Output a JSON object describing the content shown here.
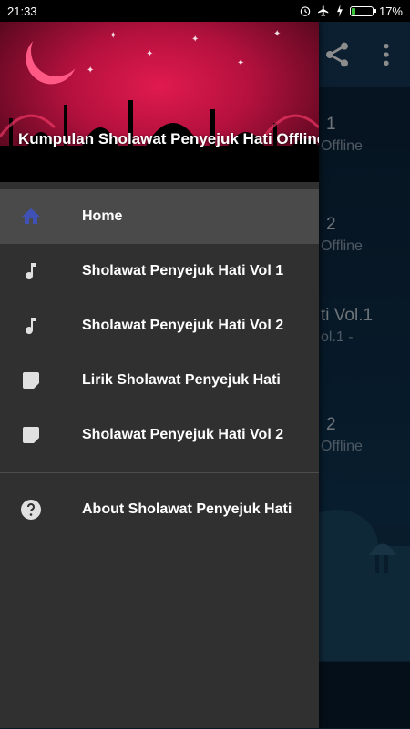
{
  "status_bar": {
    "time": "21:33",
    "battery": "17%",
    "battery_level": 0.17
  },
  "drawer": {
    "header_title": "Kumpulan Sholawat Penyejuk Hati Offline",
    "items": [
      {
        "label": "Home",
        "icon": "home-icon",
        "active": true
      },
      {
        "label": "Sholawat Penyejuk Hati Vol 1",
        "icon": "music-note-icon"
      },
      {
        "label": "Sholawat Penyejuk Hati Vol 2",
        "icon": "music-note-icon"
      },
      {
        "label": "Lirik Sholawat Penyejuk Hati",
        "icon": "note-icon"
      },
      {
        "label": "Sholawat Penyejuk Hati Vol 2",
        "icon": "note-icon"
      }
    ],
    "about": {
      "label": "About Sholawat Penyejuk Hati",
      "icon": "help-icon"
    }
  },
  "background_list": [
    {
      "line1": "1",
      "line2": "Offline"
    },
    {
      "line1": "2",
      "line2": "Offline"
    },
    {
      "line1": "ti Vol.1",
      "line2": "ol.1 -"
    },
    {
      "line1": "2",
      "line2": "Offline"
    }
  ],
  "colors": {
    "accent": "#3f51b5",
    "drawer_bg": "#303030",
    "active_bg": "#4a4a4a"
  }
}
